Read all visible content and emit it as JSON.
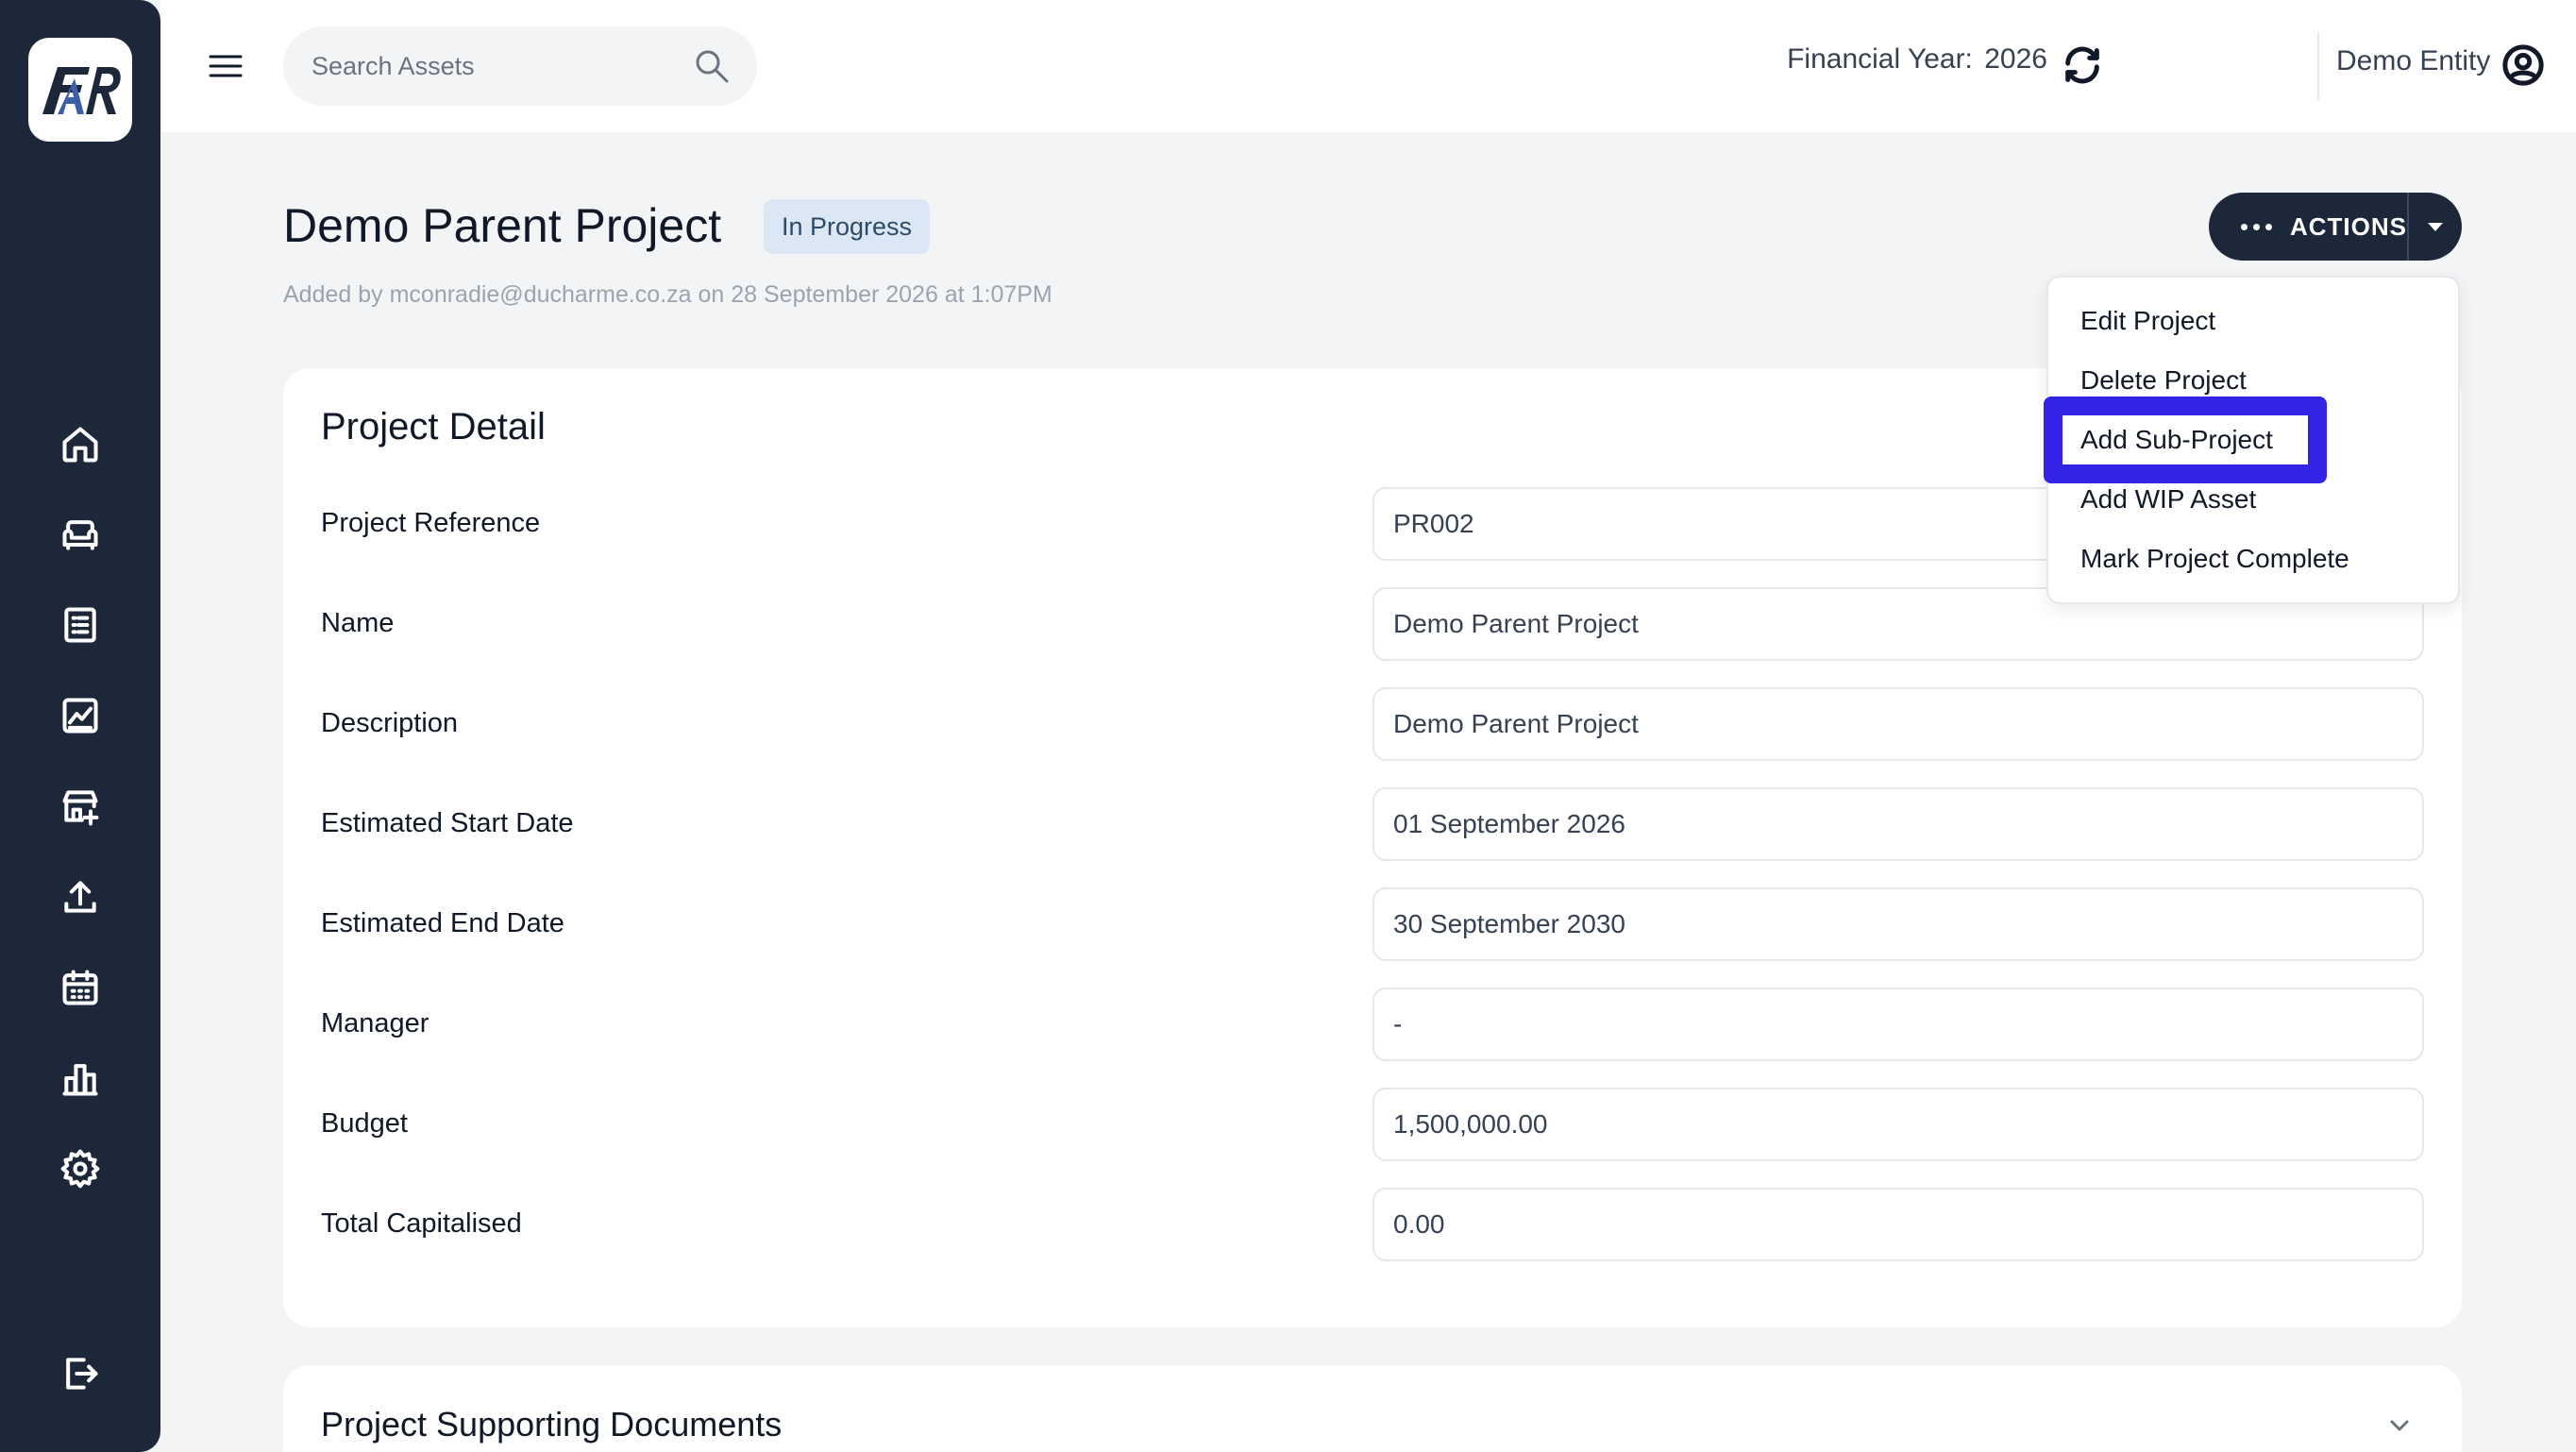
{
  "app": {
    "logo_text": "FAR"
  },
  "topbar": {
    "search_placeholder": "Search Assets",
    "financial_year_label": "Financial Year:",
    "financial_year_value": "2026",
    "entity_name": "Demo Entity"
  },
  "sidebar": {
    "icons": [
      "home-icon",
      "sofa-icon",
      "list-icon",
      "chart-icon",
      "store-add-icon",
      "upload-icon",
      "calendar-icon",
      "bar-chart-icon",
      "settings-icon",
      "logout-icon"
    ]
  },
  "page": {
    "title": "Demo Parent Project",
    "status": "In Progress",
    "added_by": "Added by mconradie@ducharme.co.za on 28 September 2026 at 1:07PM",
    "actions_label": "ACTIONS"
  },
  "actions_menu": {
    "items": [
      "Edit Project",
      "Delete Project",
      "Add Sub-Project",
      "Add WIP Asset",
      "Mark Project Complete"
    ],
    "highlighted": "Add Sub-Project",
    "highlight_color": "#3323e4"
  },
  "project_detail": {
    "title": "Project Detail",
    "fields": [
      {
        "label": "Project Reference",
        "value": "PR002"
      },
      {
        "label": "Name",
        "value": "Demo Parent Project"
      },
      {
        "label": "Description",
        "value": "Demo Parent Project"
      },
      {
        "label": "Estimated Start Date",
        "value": "01 September 2026"
      },
      {
        "label": "Estimated End Date",
        "value": "30 September 2030"
      },
      {
        "label": "Manager",
        "value": "-"
      },
      {
        "label": "Budget",
        "value": "1,500,000.00"
      },
      {
        "label": "Total Capitalised",
        "value": "0.00"
      }
    ]
  },
  "documents": {
    "title": "Project Supporting Documents"
  },
  "colors": {
    "sidebar": "#1c2739",
    "badge_bg": "#dbe7f4",
    "page_bg": "#f3f4f6"
  }
}
